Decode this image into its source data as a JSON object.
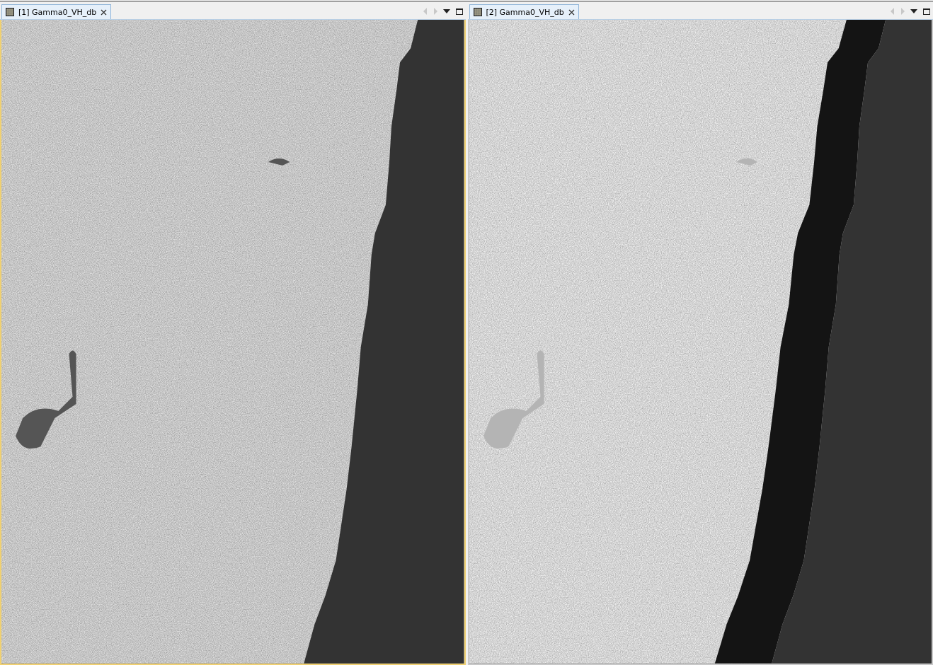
{
  "panels": [
    {
      "tab": {
        "label": "[1] Gamma0_VH_db",
        "selected": true
      },
      "active": true,
      "image": {
        "kind": "plain"
      }
    },
    {
      "tab": {
        "label": "[2] Gamma0_VH_db",
        "selected": true
      },
      "active": false,
      "image": {
        "kind": "shadowed"
      }
    }
  ]
}
